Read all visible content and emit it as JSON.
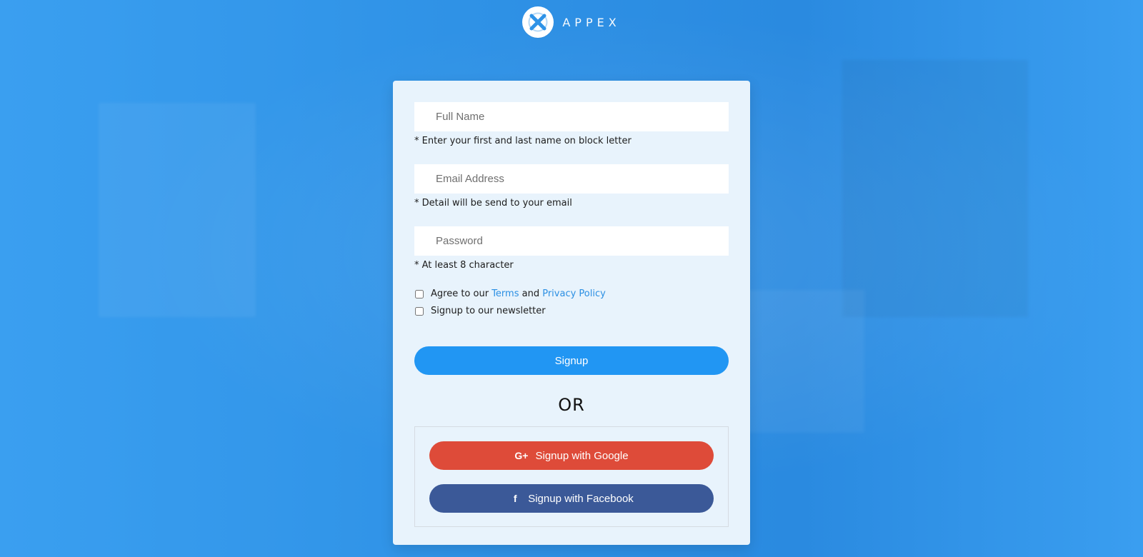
{
  "brand": {
    "name": "APPEX",
    "logo_icon": "appex-logo-icon"
  },
  "form": {
    "full_name": {
      "placeholder": "Full Name",
      "hint": "* Enter your first and last name on block letter"
    },
    "email": {
      "placeholder": "Email Address",
      "hint": "* Detail will be send to your email"
    },
    "password": {
      "placeholder": "Password",
      "hint": "* At least 8 character"
    },
    "agree": {
      "prefix": "Agree to our ",
      "terms": "Terms",
      "middle": " and ",
      "privacy": "Privacy Policy"
    },
    "newsletter": {
      "label": "Signup to our newsletter"
    },
    "signup_button": "Signup",
    "or_text": "OR",
    "google_button": "Signup with Google",
    "facebook_button": "Signup with Facebook"
  },
  "colors": {
    "background_blue": "#2f93e7",
    "card_bg": "#e8f3fc",
    "primary_blue": "#2196f3",
    "google_red": "#de4b39",
    "facebook_blue": "#3b5998",
    "link_blue": "#2b8fe3"
  },
  "icons": {
    "google": "google-plus-icon",
    "facebook": "facebook-icon"
  }
}
